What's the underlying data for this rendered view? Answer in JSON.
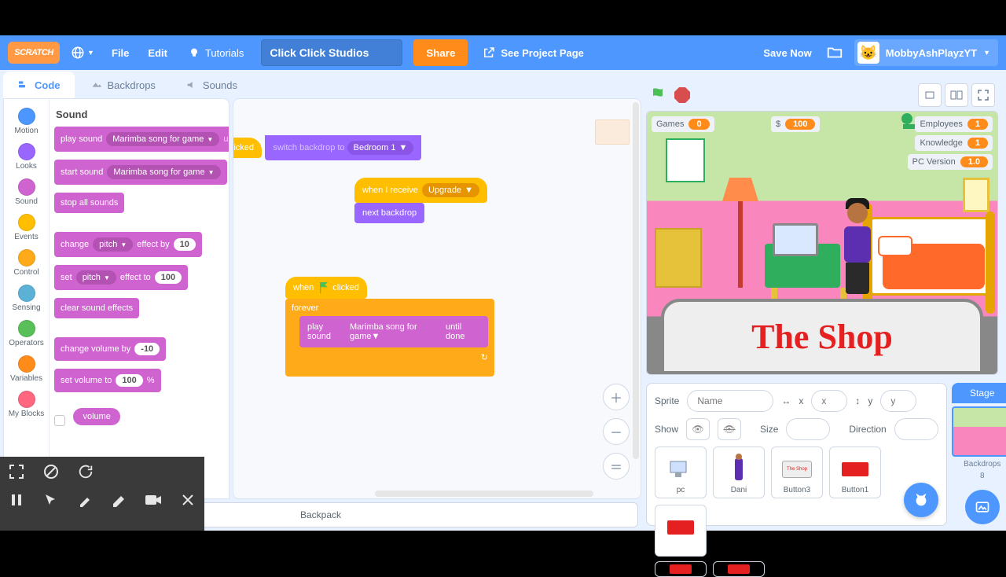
{
  "menubar": {
    "logo": "SCRATCH",
    "file": "File",
    "edit": "Edit",
    "tutorials": "Tutorials",
    "project_title": "Click Click Studios",
    "share": "Share",
    "see_project_page": "See Project Page",
    "save_now": "Save Now",
    "username": "MobbyAshPlayzYT"
  },
  "tabs": {
    "code": "Code",
    "backdrops": "Backdrops",
    "sounds": "Sounds"
  },
  "categories": [
    {
      "name": "Motion",
      "color": "#4c97ff"
    },
    {
      "name": "Looks",
      "color": "#9966ff"
    },
    {
      "name": "Sound",
      "color": "#cf63cf"
    },
    {
      "name": "Events",
      "color": "#ffbf00"
    },
    {
      "name": "Control",
      "color": "#ffab19"
    },
    {
      "name": "Sensing",
      "color": "#5cb1d6"
    },
    {
      "name": "Operators",
      "color": "#59c059"
    },
    {
      "name": "Variables",
      "color": "#ff8c1a"
    },
    {
      "name": "My Blocks",
      "color": "#ff6680"
    }
  ],
  "palette": {
    "heading": "Sound",
    "play_sound": "play sound",
    "sound_name": "Marimba song for game",
    "until_done": "until done",
    "start_sound": "start sound",
    "stop_all": "stop all sounds",
    "change": "change",
    "pitch": "pitch",
    "effect_by": "effect by",
    "val10": "10",
    "set": "set",
    "effect_to": "effect to",
    "val100": "100",
    "clear_effects": "clear sound effects",
    "change_vol": "change volume by",
    "valm10": "-10",
    "set_vol": "set volume to",
    "pct": "%",
    "volume": "volume"
  },
  "scripts": {
    "hat_clicked": "clicked",
    "switch_backdrop": "switch backdrop to",
    "bedroom1": "Bedroom 1",
    "when_receive": "when I receive",
    "upgrade": "Upgrade",
    "next_backdrop": "next backdrop",
    "when_flag": "when",
    "clicked2": "clicked",
    "forever": "forever",
    "play_sound": "play sound",
    "sound_name": "Marimba song for game",
    "until_done": "until done"
  },
  "hud": {
    "games": "Games",
    "games_val": "0",
    "money": "$",
    "money_val": "100",
    "employees": "Employees",
    "employees_val": "1",
    "knowledge": "Knowledge",
    "knowledge_val": "1",
    "pcver": "PC Version",
    "pcver_val": "1.0"
  },
  "shop_text": "The Shop",
  "sprite_info": {
    "sprite_lbl": "Sprite",
    "name_ph": "Name",
    "x_lbl": "x",
    "x_val": "x",
    "y_lbl": "y",
    "y_val": "y",
    "show_lbl": "Show",
    "size_lbl": "Size",
    "dir_lbl": "Direction"
  },
  "sprites": [
    "pc",
    "Dani",
    "Button3",
    "Button1"
  ],
  "stage_side": {
    "label": "Stage",
    "backdrops": "Backdrops",
    "count": "8"
  },
  "backpack": "Backpack"
}
